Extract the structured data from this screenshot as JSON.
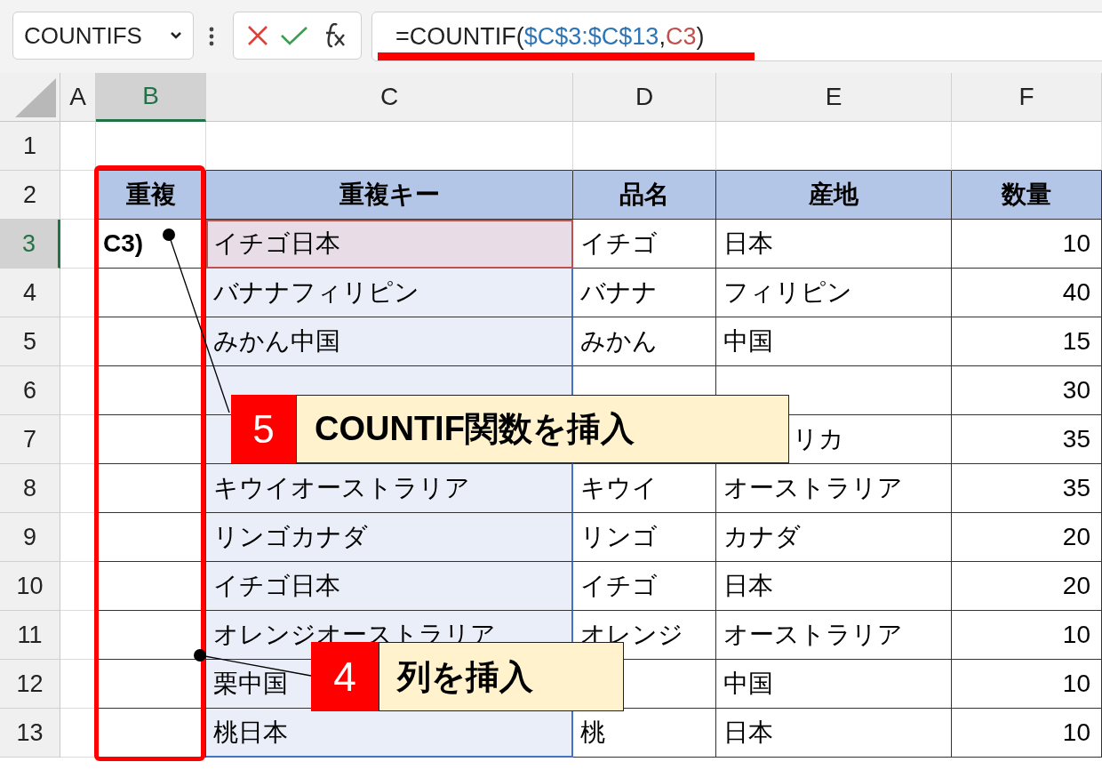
{
  "name_box": {
    "value": "COUNTIFS"
  },
  "formula_bar": {
    "parts": [
      {
        "text": "=COUNTIF(",
        "color": "#222222"
      },
      {
        "text": "$C$3:$C$13",
        "color": "#2e75b6"
      },
      {
        "text": ",",
        "color": "#222222"
      },
      {
        "text": "C3",
        "color": "#c0504d"
      },
      {
        "text": ")",
        "color": "#222222"
      }
    ]
  },
  "columns": [
    {
      "label": "A",
      "selected": false
    },
    {
      "label": "B",
      "selected": true
    },
    {
      "label": "C",
      "selected": false
    },
    {
      "label": "D",
      "selected": false
    },
    {
      "label": "E",
      "selected": false
    },
    {
      "label": "F",
      "selected": false
    }
  ],
  "rows": [
    {
      "number": "1",
      "selected": false,
      "kind": "blank",
      "cells": {}
    },
    {
      "number": "2",
      "selected": false,
      "kind": "header",
      "cells": {
        "B": {
          "text": "重複"
        },
        "C": {
          "text": "重複キー"
        },
        "D": {
          "text": "品名"
        },
        "E": {
          "text": "産地"
        },
        "F": {
          "text": "数量"
        }
      }
    },
    {
      "number": "3",
      "selected": true,
      "kind": "data",
      "cells": {
        "B": {
          "text": "C3)",
          "kind": "editing"
        },
        "C": {
          "text": "イチゴ日本",
          "kind": "active"
        },
        "D": {
          "text": "イチゴ"
        },
        "E": {
          "text": "日本"
        },
        "F": {
          "text": "10"
        }
      }
    },
    {
      "number": "4",
      "selected": false,
      "kind": "data",
      "cells": {
        "C": {
          "text": "バナナフィリピン"
        },
        "D": {
          "text": "バナナ"
        },
        "E": {
          "text": "フィリピン"
        },
        "F": {
          "text": "40"
        }
      }
    },
    {
      "number": "5",
      "selected": false,
      "kind": "data",
      "cells": {
        "C": {
          "text": "みかん中国"
        },
        "D": {
          "text": "みかん"
        },
        "E": {
          "text": "中国"
        },
        "F": {
          "text": "15"
        }
      }
    },
    {
      "number": "6",
      "selected": false,
      "kind": "data",
      "cells": {
        "F": {
          "text": "30"
        }
      }
    },
    {
      "number": "7",
      "selected": false,
      "kind": "data",
      "cells": {
        "E": {
          "text": "リカ",
          "start_hidden": true
        },
        "F": {
          "text": "35"
        }
      }
    },
    {
      "number": "8",
      "selected": false,
      "kind": "data",
      "cells": {
        "C": {
          "text": "キウイオーストラリア"
        },
        "D": {
          "text": "キウイ"
        },
        "E": {
          "text": "オーストラリア"
        },
        "F": {
          "text": "35"
        }
      }
    },
    {
      "number": "9",
      "selected": false,
      "kind": "data",
      "cells": {
        "C": {
          "text": "リンゴカナダ"
        },
        "D": {
          "text": "リンゴ"
        },
        "E": {
          "text": "カナダ"
        },
        "F": {
          "text": "20"
        }
      }
    },
    {
      "number": "10",
      "selected": false,
      "kind": "data",
      "cells": {
        "C": {
          "text": "イチゴ日本"
        },
        "D": {
          "text": "イチゴ"
        },
        "E": {
          "text": "日本"
        },
        "F": {
          "text": "20"
        }
      }
    },
    {
      "number": "11",
      "selected": false,
      "kind": "data",
      "cells": {
        "C": {
          "text": "オレンジオーストラリア"
        },
        "D": {
          "text": "オレンジ"
        },
        "E": {
          "text": "オーストラリア"
        },
        "F": {
          "text": "10"
        }
      }
    },
    {
      "number": "12",
      "selected": false,
      "kind": "data",
      "cells": {
        "C": {
          "text": "栗中国"
        },
        "E": {
          "text": "中国"
        },
        "F": {
          "text": "10"
        }
      }
    },
    {
      "number": "13",
      "selected": false,
      "kind": "data",
      "cells": {
        "C": {
          "text": "桃日本"
        },
        "D": {
          "text": "桃"
        },
        "E": {
          "text": "日本"
        },
        "F": {
          "text": "10"
        }
      }
    }
  ],
  "callouts": [
    {
      "number": "5",
      "text": "COUNTIF関数を挿入"
    },
    {
      "number": "4",
      "text": "列を挿入"
    }
  ]
}
